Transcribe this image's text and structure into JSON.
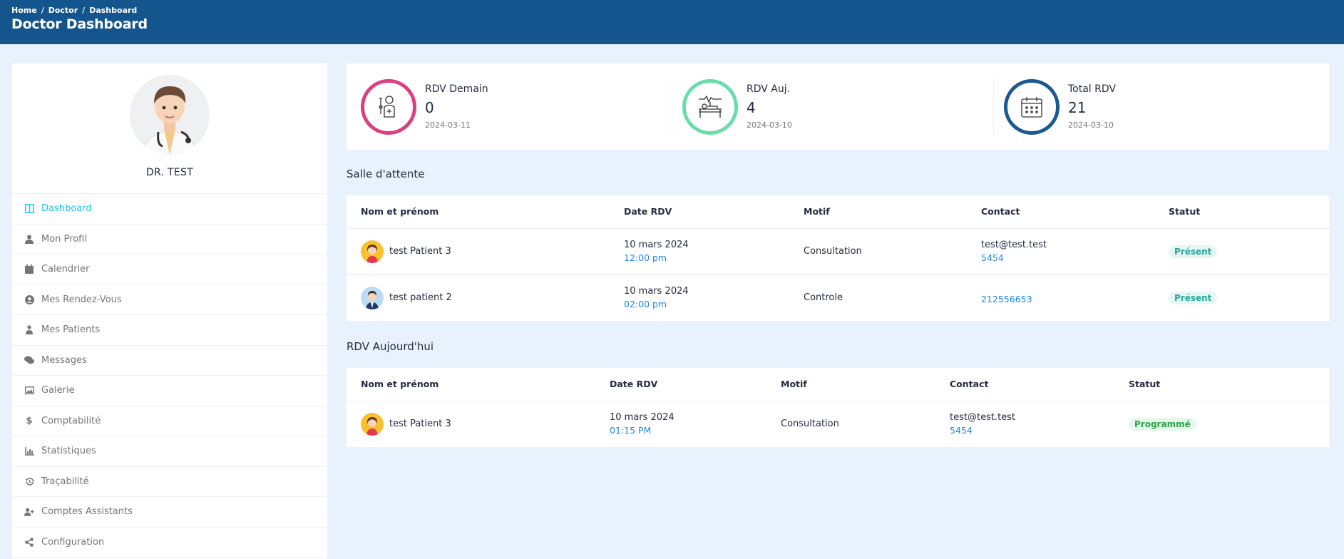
{
  "header": {
    "breadcrumb": [
      "Home",
      "Doctor",
      "Dashboard"
    ],
    "title": "Doctor Dashboard"
  },
  "profile": {
    "name": "DR. TEST"
  },
  "menu": [
    {
      "label": "Dashboard",
      "icon": "columns-icon",
      "active": true
    },
    {
      "label": "Mon Profil",
      "icon": "user-icon"
    },
    {
      "label": "Calendrier",
      "icon": "calendar-icon"
    },
    {
      "label": "Mes Rendez-Vous",
      "icon": "user-circle-icon"
    },
    {
      "label": "Mes Patients",
      "icon": "users-icon"
    },
    {
      "label": "Messages",
      "icon": "comments-icon"
    },
    {
      "label": "Galerie",
      "icon": "image-icon"
    },
    {
      "label": "Comptabilité",
      "icon": "dollar-icon"
    },
    {
      "label": "Statistiques",
      "icon": "chart-icon"
    },
    {
      "label": "Traçabilité",
      "icon": "history-icon"
    },
    {
      "label": "Comptes Assistants",
      "icon": "user-plus-icon"
    },
    {
      "label": "Configuration",
      "icon": "share-icon"
    }
  ],
  "stats": [
    {
      "label": "RDV Demain",
      "value": "0",
      "date": "2024-03-11",
      "color": "#da3f81",
      "icon": "patient-icon"
    },
    {
      "label": "RDV Auj.",
      "value": "4",
      "date": "2024-03-10",
      "color": "#68dda9",
      "icon": "hospital-bed-icon"
    },
    {
      "label": "Total RDV",
      "value": "21",
      "date": "2024-03-10",
      "color": "#1b5a90",
      "icon": "calendar-icon"
    }
  ],
  "waiting": {
    "title": "Salle d'attente",
    "columns": [
      "Nom et prénom",
      "Date RDV",
      "Motif",
      "Contact",
      "Statut"
    ],
    "rows": [
      {
        "name": "test Patient 3",
        "date": "10 mars 2024",
        "time": "12:00 pm",
        "motif": "Consultation",
        "email": "test@test.test",
        "phone": "5454",
        "status": "Présent",
        "avatar": "female"
      },
      {
        "name": "test patient 2",
        "date": "10 mars 2024",
        "time": "02:00 pm",
        "motif": "Controle",
        "email": "",
        "phone": "212556653",
        "status": "Présent",
        "avatar": "male"
      }
    ]
  },
  "today": {
    "title": "RDV Aujourd'hui",
    "columns": [
      "Nom et prénom",
      "Date RDV",
      "Motif",
      "Contact",
      "Statut"
    ],
    "rows": [
      {
        "name": "test Patient 3",
        "date": "10 mars 2024",
        "time": "01:15 PM",
        "motif": "Consultation",
        "email": "test@test.test",
        "phone": "5454",
        "status": "Programmé",
        "avatar": "female"
      }
    ]
  }
}
